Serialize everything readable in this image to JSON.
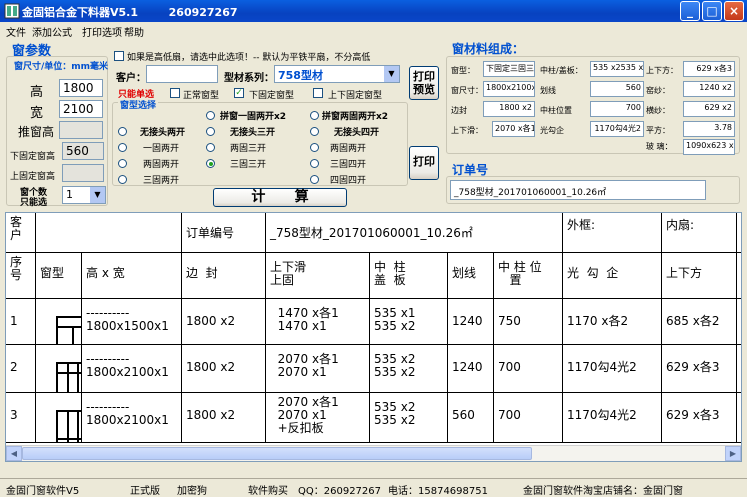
{
  "window": {
    "title": "金固铝合金下料器V5.1        260927267"
  },
  "menu": [
    "文件",
    "添加公式",
    "打印选项",
    "帮助"
  ],
  "left": {
    "section_title": "窗参数",
    "unit_label": "窗尺寸/单位：mm毫米",
    "height_label": "高",
    "height_value": "1800",
    "width_label": "宽",
    "width_value": "2100",
    "push_height_label": "推窗高",
    "lower_fixed_label": "下固定窗高",
    "lower_fixed_value": "560",
    "upper_fixed_label": "上固定窗高",
    "count_label_1": "窗个数",
    "count_label_2": "只能选",
    "count_value": "1"
  },
  "middle": {
    "high_low_label": "如果是高低扇，请选中此选项！-- 默认为平铁平扇，不分高低",
    "customer_label": "客户：",
    "customer_value": "",
    "series_label": "型材系列：",
    "series_value": "758型材",
    "single_only": "只能单选",
    "normal_window": "正常窗型",
    "lower_fixed": "下固定窗型",
    "upper_lower_fixed": "上下固定窗型",
    "window_select": "窗型选择",
    "radios": [
      {
        "label": "拼窗一固两开x2",
        "on": false
      },
      {
        "label": "拼窗两固两开x2",
        "on": false
      },
      {
        "label": "无接头两开",
        "on": false
      },
      {
        "label": "无接头三开",
        "on": false
      },
      {
        "label": "无接头四开",
        "on": false
      },
      {
        "label": "一固两开",
        "on": false
      },
      {
        "label": "两固三开",
        "on": false
      },
      {
        "label": "两固两开",
        "on": false
      },
      {
        "label": "两固两开",
        "on": false
      },
      {
        "label": "三固三开",
        "on": true
      },
      {
        "label": "三固四开",
        "on": false
      },
      {
        "label": "三固两开",
        "on": false
      },
      {
        "label": "四固四开",
        "on": false
      }
    ],
    "calc_button": "计      算"
  },
  "buttons": {
    "print_preview": "打印\n预览",
    "print": "打印"
  },
  "right": {
    "section_title": "窗材料组成：",
    "rows": [
      {
        "l1": "窗型：",
        "v1": "下固定三固三",
        "l2": "中柱/盖板：",
        "v2": "535 x2535 x",
        "l3": "上下方：",
        "v3": "629 x各3"
      },
      {
        "l1": "窗尺寸：",
        "v1": "1800x2100x1",
        "l2": "划线",
        "v2": "560",
        "l3": "窑纱：",
        "v3": "1240 x2"
      },
      {
        "l1": "边封",
        "v1": "1800 x2",
        "l2": "中柱位置",
        "v2": "700",
        "l3": "横纱：",
        "v3": "629 x2"
      },
      {
        "l1": "上下滑：",
        "v1": "2070 x各1",
        "l2": "光勾企",
        "v2": "1170勾4光2",
        "l3": "平方：",
        "v3": "3.78"
      }
    ],
    "glass_label": "玻 璃：",
    "glass_value": "1090x623 x3",
    "order_label": "订单号",
    "order_value": "_758型材_201701060001_10.26㎡"
  },
  "table": {
    "customer_label": "客\n户",
    "order_no_label": "订单编号",
    "order_no_value": "_758型材_201701060001_10.26㎡",
    "outer_frame": "外框:",
    "inner_sash": "内扇:",
    "headers": [
      "序\n号",
      "窗型",
      "高 x 宽",
      "边  封",
      "上下滑\n上固",
      "中  柱\n盖  板",
      "划线",
      "中 柱 位\n   置",
      "光  勾  企",
      "上下方"
    ],
    "rows": [
      {
        "no": "1",
        "size": "----------\n1800x1500x1",
        "edge": "1800 x2",
        "slide": "  1470 x各1\n  1470 x1",
        "mullion": "535 x1\n535 x2",
        "line": "1240",
        "pos": "750",
        "hook": "1170 x各2",
        "top": "685 x各2"
      },
      {
        "no": "2",
        "size": "----------\n1800x2100x1",
        "edge": "1800 x2",
        "slide": "  2070 x各1\n  2070 x1",
        "mullion": "535 x2\n535 x2",
        "line": "1240",
        "pos": "700",
        "hook": "1170勾4光2",
        "top": "629 x各3"
      },
      {
        "no": "3",
        "size": "----------\n1800x2100x1",
        "edge": "1800 x2",
        "slide": "  2070 x各1\n  2070 x1\n  +反扣板",
        "mullion": "535 x2\n535 x2",
        "line": "560",
        "pos": "700",
        "hook": "1170勾4光2",
        "top": "629 x各3"
      }
    ]
  },
  "status": [
    "金固门窗软件V5",
    "正式版",
    "加密狗",
    "软件购买",
    "QQ：260927267",
    "电话：15874698751",
    "金固门窗软件淘宝店铺名：金固门窗"
  ]
}
